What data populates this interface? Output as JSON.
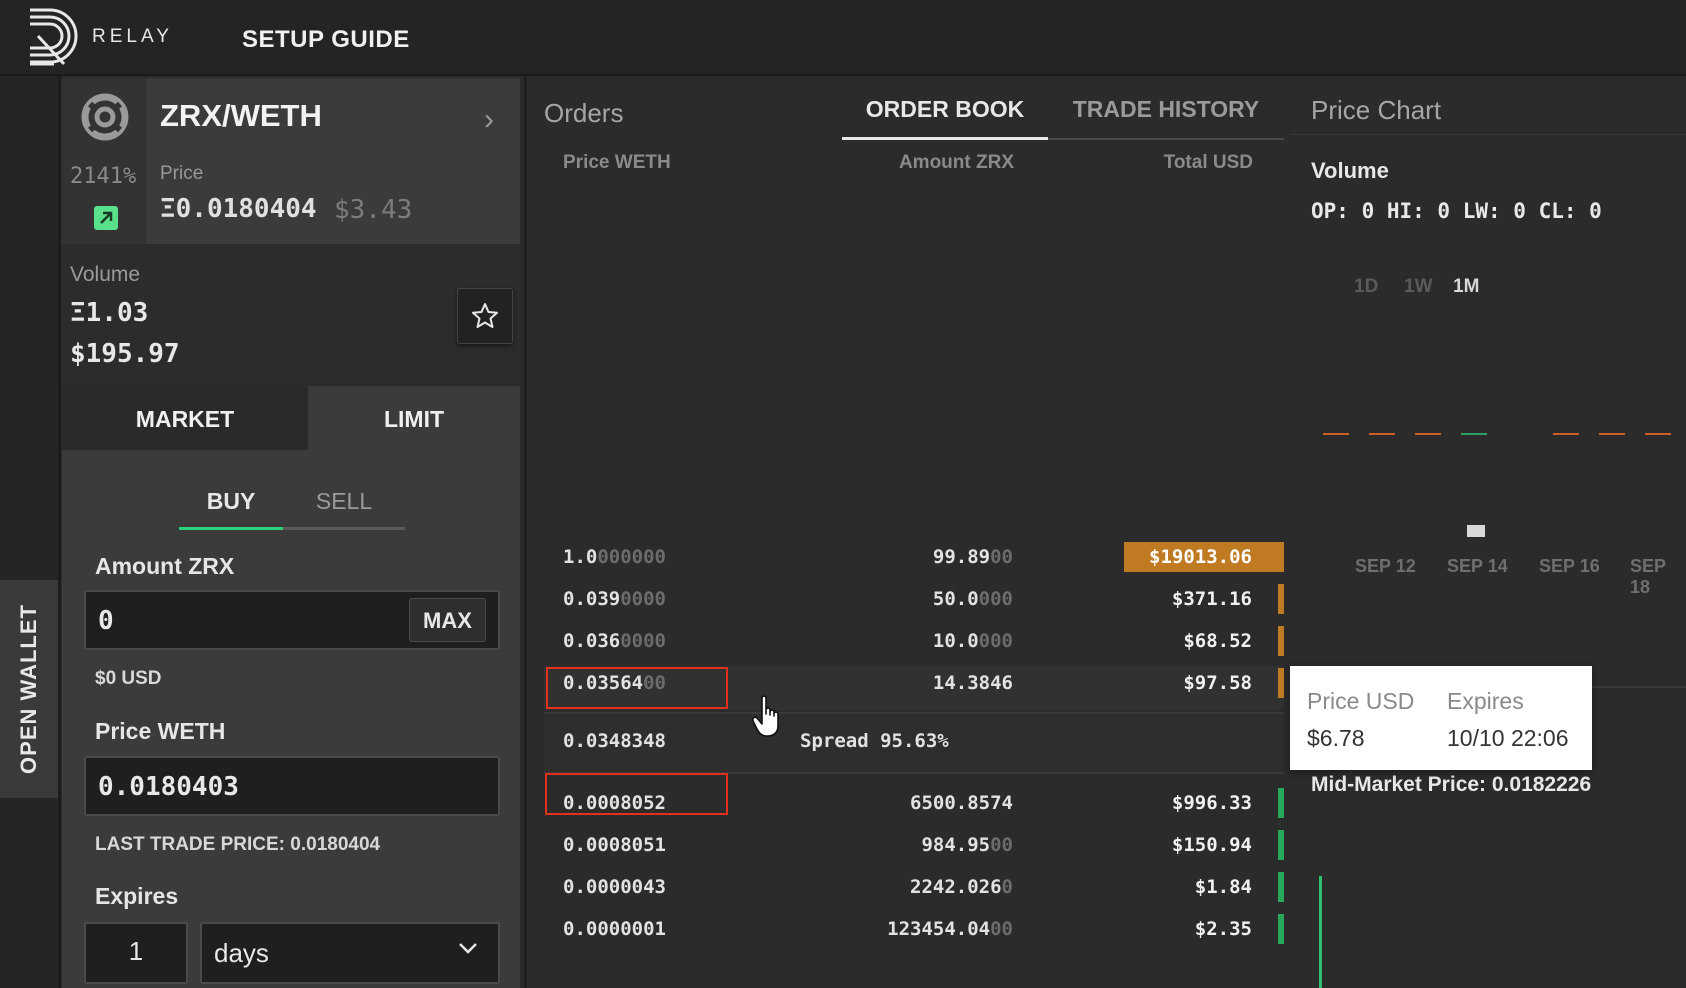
{
  "header": {
    "brand": "RELAY",
    "setup_guide": "SETUP GUIDE"
  },
  "sidebar": {
    "open_wallet": "OPEN WALLET"
  },
  "market": {
    "pair": "ZRX/WETH",
    "change": "2141%",
    "price_label": "Price",
    "price_weth": "Ξ0.0180404",
    "price_usd": "$3.43",
    "volume_label": "Volume",
    "volume_weth": "Ξ1.03",
    "volume_usd": "$195.97"
  },
  "order_form": {
    "tabs": [
      "MARKET",
      "LIMIT"
    ],
    "active_tab": "LIMIT",
    "sides": [
      "BUY",
      "SELL"
    ],
    "active_side": "BUY",
    "amount_label": "Amount ZRX",
    "amount_value": "0",
    "max_label": "MAX",
    "amount_usd": "$0 USD",
    "price_label": "Price WETH",
    "price_value": "0.0180403",
    "last_trade": "LAST TRADE PRICE: 0.0180404",
    "expires_label": "Expires",
    "expires_value": "1",
    "expires_unit": "days"
  },
  "orders": {
    "title": "Orders",
    "tabs": [
      "ORDER BOOK",
      "TRADE HISTORY"
    ],
    "active_tab": "ORDER BOOK",
    "columns": [
      "Price WETH",
      "Amount ZRX",
      "Total USD"
    ],
    "asks": [
      {
        "price": "1.0",
        "price_pad": "000000",
        "amount": "99.89",
        "amount_pad": "00",
        "total": "$19013.06"
      },
      {
        "price": "0.039",
        "price_pad": "0000",
        "amount": "50.0",
        "amount_pad": "000",
        "total": "$371.16"
      },
      {
        "price": "0.036",
        "price_pad": "0000",
        "amount": "10.0",
        "amount_pad": "000",
        "total": "$68.52"
      },
      {
        "price": "0.03564",
        "price_pad": "00",
        "amount": "14.3846",
        "amount_pad": "",
        "total": "$97.58"
      }
    ],
    "spread_price": "0.0348348",
    "spread_label": "Spread 95.63%",
    "bids": [
      {
        "price": "0.0008052",
        "price_pad": "",
        "amount": "6500.8574",
        "amount_pad": "",
        "total": "$996.33"
      },
      {
        "price": "0.0008051",
        "price_pad": "",
        "amount": "984.95",
        "amount_pad": "00",
        "total": "$150.94"
      },
      {
        "price": "0.0000043",
        "price_pad": "",
        "amount": "2242.026",
        "amount_pad": "0",
        "total": "$1.84"
      },
      {
        "price": "0.0000001",
        "price_pad": "",
        "amount": "123454.04",
        "amount_pad": "00",
        "total": "$2.35"
      }
    ],
    "depth": {
      "asks": [
        1.0,
        0.04,
        0.04,
        0.04
      ],
      "bids": [
        0.04,
        0.04,
        0.04,
        0.04
      ]
    }
  },
  "chart": {
    "title": "Price Chart",
    "volume_label": "Volume",
    "ohlc": "OP: 0 HI: 0 LW: 0 CL: 0",
    "ranges": [
      "1D",
      "1W",
      "1M"
    ],
    "active_range": "1M",
    "dates": [
      "SEP 12",
      "SEP 14",
      "SEP 16",
      "SEP 18"
    ],
    "mid_market": "Mid-Market Price: 0.0182226"
  },
  "tooltip": {
    "price_label": "Price USD",
    "price_value": "$6.78",
    "expires_label": "Expires",
    "expires_value": "10/10 22:06"
  },
  "colors": {
    "ask": "#c07a22",
    "bid": "#27a85a",
    "accent_green": "#2fd07a",
    "highlight_red": "#e0301e"
  }
}
